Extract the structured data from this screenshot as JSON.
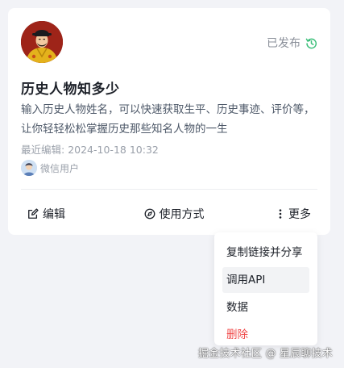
{
  "card": {
    "status": "已发布",
    "title": "历史人物知多少",
    "description": "输入历史人物姓名，可以快速获取生平、历史事迹、评价等，让你轻轻松松掌握历史那些知名人物的一生",
    "last_edited_label": "最近编辑:",
    "last_edited_time": "2024-10-18 10:32",
    "author": "微信用户",
    "avatar_icon": "emperor-portrait-icon",
    "colors": {
      "status_icon": "#3cbf7a",
      "danger": "#f04848"
    }
  },
  "actions": {
    "edit": "编辑",
    "usage": "使用方式",
    "more": "更多"
  },
  "menu": {
    "items": [
      {
        "label": "复制链接并分享"
      },
      {
        "label": "调用API"
      },
      {
        "label": "数据"
      },
      {
        "label": "删除"
      }
    ]
  },
  "watermark": "掘金技术社区 @ 星辰聊技术"
}
